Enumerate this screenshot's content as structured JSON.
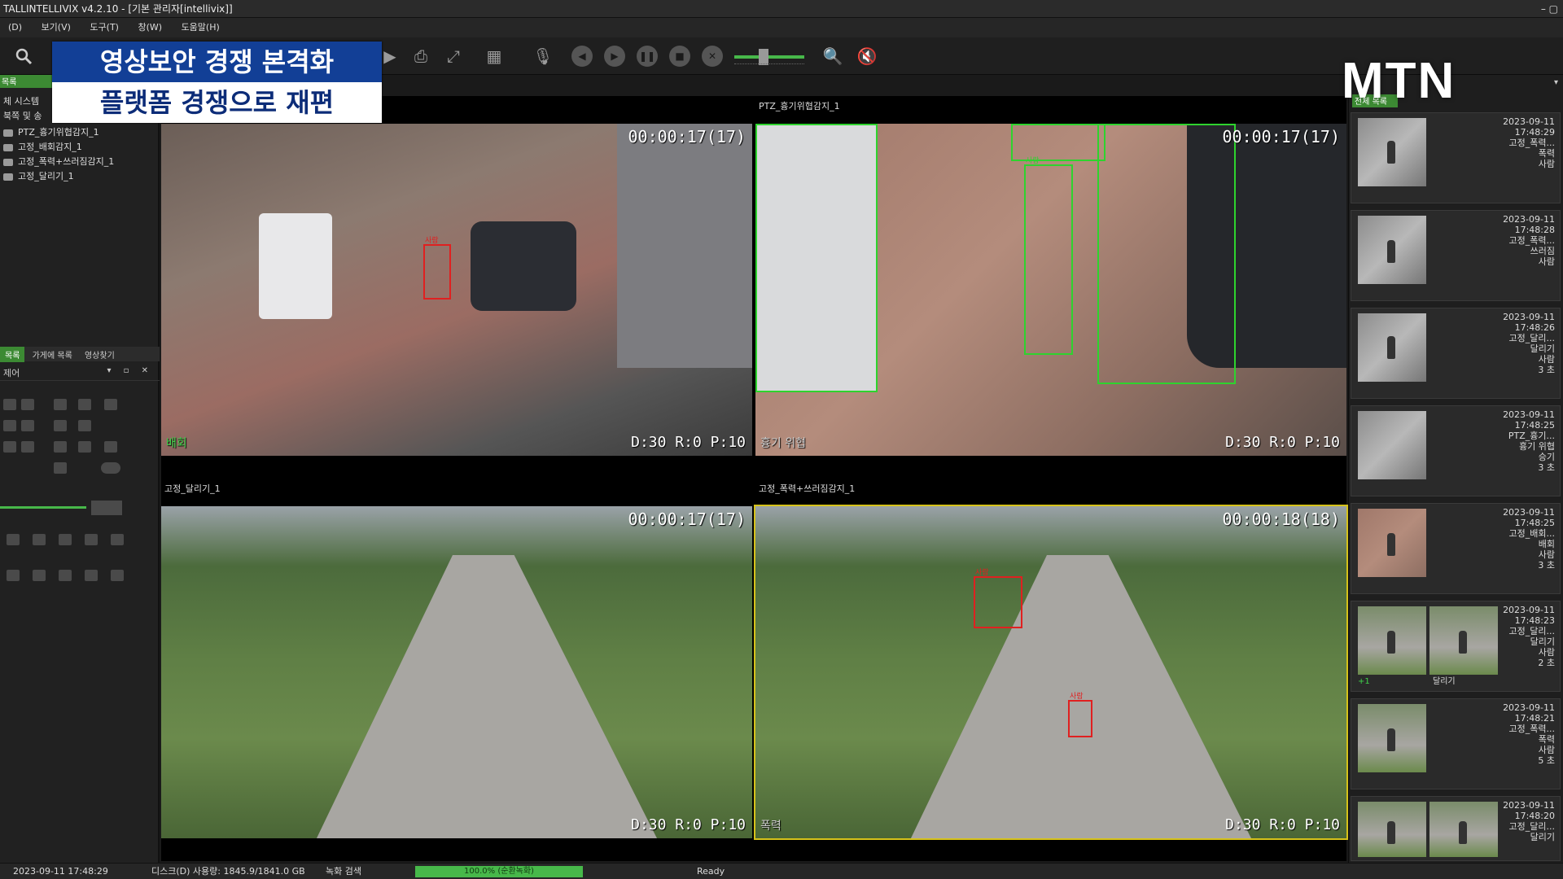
{
  "window": {
    "title": "TALLINTELLIVIX v4.2.10 - [기본 관리자[intellivix]]",
    "controls": "–  ▢"
  },
  "menu": [
    "(D)",
    "보기(V)",
    "도구(T)",
    "창(W)",
    "도움말(H)"
  ],
  "caption": {
    "line1": "영상보안 경쟁 본격화",
    "line2": "플랫폼 경쟁으로 재편"
  },
  "logo": "MTN",
  "left_panel": {
    "header": "목록",
    "tree": [
      "체 시스템",
      "북쪽 및 송",
      "PTZ_흉기위협감지_1",
      "고정_배회감지_1",
      "고정_폭력+쓰러짐감지_1",
      "고정_달리기_1"
    ],
    "tabs": [
      "목록",
      "가게에 목록",
      "영상찾기"
    ],
    "ptz_title": "제어",
    "ptz_controls": "▾ ▫ ✕"
  },
  "video": {
    "tiles": [
      {
        "label": "",
        "timestamp": "00:00:17(17)",
        "stats": "D:30 R:0 P:10",
        "event": "배회",
        "event_green": true
      },
      {
        "label": "PTZ_흉기위협감지_1",
        "timestamp": "00:00:17(17)",
        "stats": "D:30 R:0 P:10",
        "event": "흉기 위협",
        "event_green": false
      },
      {
        "label": "고정_달리기_1",
        "timestamp": "00:00:17(17)",
        "stats": "D:30 R:0 P:10",
        "event": "",
        "event_green": false
      },
      {
        "label": "고정_폭력+쓰러짐감지_1",
        "timestamp": "00:00:18(18)",
        "stats": "D:30 R:0 P:10",
        "event": "폭력",
        "event_green": false
      }
    ],
    "box_tag": "사람"
  },
  "right_panel": {
    "header": "전체 목록",
    "dropdown": "▾",
    "events": [
      {
        "meta": "2023-09-11\n17:48:29\n고정_폭력...\n폭력\n사람",
        "extra": "",
        "extra2": ""
      },
      {
        "meta": "2023-09-11\n17:48:28\n고정_폭력...\n쓰러짐\n사람",
        "extra": "",
        "extra2": ""
      },
      {
        "meta": "2023-09-11\n17:48:26\n고정_달리...\n달리기\n사람\n3 초",
        "extra": "",
        "extra2": ""
      },
      {
        "meta": "2023-09-11\n17:48:25\nPTZ_흉기...\n흉기 위협\n승기\n3 초",
        "extra": "",
        "extra2": ""
      },
      {
        "meta": "2023-09-11\n17:48:25\n고정_배회...\n배회\n사람\n3 초",
        "extra": "",
        "extra2": ""
      },
      {
        "meta": "2023-09-11\n17:48:23\n고정_달리...\n달리기\n사람\n2 초",
        "extra": "+1",
        "extra2": "달리기"
      },
      {
        "meta": "2023-09-11\n17:48:21\n고정_폭력...\n폭력\n사람\n5 초",
        "extra": "",
        "extra2": ""
      },
      {
        "meta": "2023-09-11\n17:48:20\n고정_달리...\n달리기",
        "extra": "",
        "extra2": ""
      }
    ]
  },
  "status": {
    "datetime": "2023-09-11 17:48:29",
    "disk": "디스크(D) 사용량: 1845.9/1841.0 GB",
    "search": "녹화 검색",
    "progress_text": "100.0% (순환녹화)",
    "progress_fraction": 1.0,
    "ready": "Ready"
  },
  "colors": {
    "accent_green": "#47b84a",
    "alert_red": "#e02020",
    "caption_blue": "#123f96",
    "selection_yellow": "#d6c21a"
  }
}
